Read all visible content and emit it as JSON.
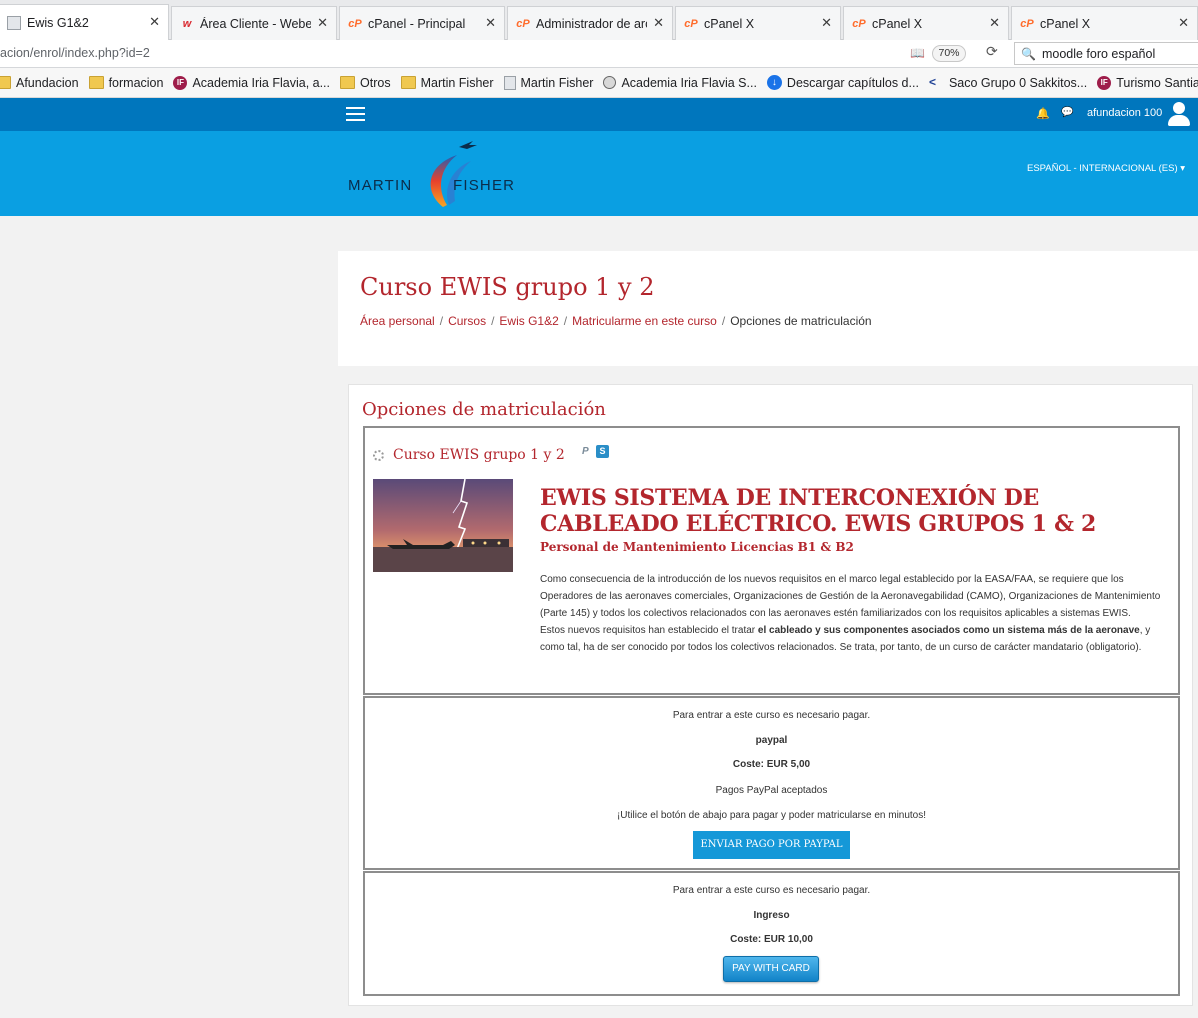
{
  "browser": {
    "tabs": [
      {
        "title": "Ewis G1&2",
        "icon": "page-icon",
        "active": true
      },
      {
        "title": "Área Cliente - Webempresa",
        "icon": "webempresa-icon"
      },
      {
        "title": "cPanel - Principal",
        "icon": "cpanel-icon"
      },
      {
        "title": "Administrador de archivos",
        "icon": "cpanel-icon"
      },
      {
        "title": "cPanel X",
        "icon": "cpanel-icon"
      },
      {
        "title": "cPanel X",
        "icon": "cpanel-icon"
      },
      {
        "title": "cPanel X",
        "icon": "cpanel-icon"
      }
    ],
    "close_glyph": "✕",
    "url": "acion/enrol/index.php?id=2",
    "zoom": "70%",
    "search_value": "moodle foro español",
    "bookmarks": [
      {
        "label": "Afundacion",
        "icon": "folder-icon"
      },
      {
        "label": "formacion",
        "icon": "folder-icon"
      },
      {
        "label": "Academia Iria Flavia, a...",
        "icon": "academia-icon"
      },
      {
        "label": "Otros",
        "icon": "folder-icon"
      },
      {
        "label": "Martin Fisher",
        "icon": "folder-icon"
      },
      {
        "label": "Martin Fisher",
        "icon": "page-icon"
      },
      {
        "label": "Academia Iria Flavia S...",
        "icon": "globe-icon"
      },
      {
        "label": "Descargar capítulos d...",
        "icon": "download-icon"
      },
      {
        "label": "Saco Grupo 0 Sakkitos...",
        "icon": "carrefour-icon"
      },
      {
        "label": "Turismo Santiago de ...",
        "icon": "academia-icon"
      }
    ]
  },
  "moodle": {
    "user_name": "afundacion 100",
    "language": "ESPAÑOL - INTERNACIONAL (ES)",
    "logo": {
      "left": "MARTIN",
      "right": "FISHER"
    },
    "page_title": "Curso EWIS grupo 1 y 2",
    "breadcrumb": {
      "links": [
        "Área personal",
        "Cursos",
        "Ewis G1&2",
        "Matricularme en este curso"
      ],
      "current": "Opciones de matriculación",
      "separator": "/"
    },
    "section_title": "Opciones de matriculación",
    "course": {
      "name": "Curso EWIS grupo 1 y 2",
      "heading": "EWIS SISTEMA DE INTERCONEXIÓN DE CABLEADO ELÉCTRICO. EWIS GRUPOS 1 & 2",
      "subheading": "Personal de Mantenimiento Licencias B1 & B2",
      "body_1": "Como consecuencia de la introducción de los nuevos requisitos en el marco legal establecido por la EASA/FAA, se requiere que los Operadores de las aeronaves comerciales, Organizaciones de Gestión de la Aeronavegabilidad (CAMO), Organizaciones de Mantenimiento (Parte 145) y todos los colectivos relacionados con las aeronaves estén familiarizados con los requisitos aplicables a sistemas EWIS.",
      "body_2a": "Estos nuevos requisitos han establecido el tratar ",
      "body_2b": "el cableado y sus componentes asociados como un sistema más de la aeronave",
      "body_2c": ", y como tal, ha de ser conocido por todos los colectivos  relacionados. Se trata, por tanto, de un curso de carácter mandatario (obligatorio)."
    },
    "paypal": {
      "notice": "Para entrar a este curso es necesario pagar.",
      "method": "paypal",
      "cost": "Coste: EUR 5,00",
      "accepted": "Pagos PayPal aceptados",
      "hint": "¡Utilice el botón de abajo para pagar y poder matricularse en minutos!",
      "button": "ENVIAR PAGO POR PAYPAL"
    },
    "card": {
      "notice": "Para entrar a este curso es necesario pagar.",
      "method": "Ingreso",
      "cost": "Coste: EUR 10,00",
      "button": "PAY WITH CARD"
    }
  },
  "colors": {
    "nav": "#0076bd",
    "banner": "#0a9fe2",
    "accent": "#b3262d",
    "button": "#1598d8"
  }
}
